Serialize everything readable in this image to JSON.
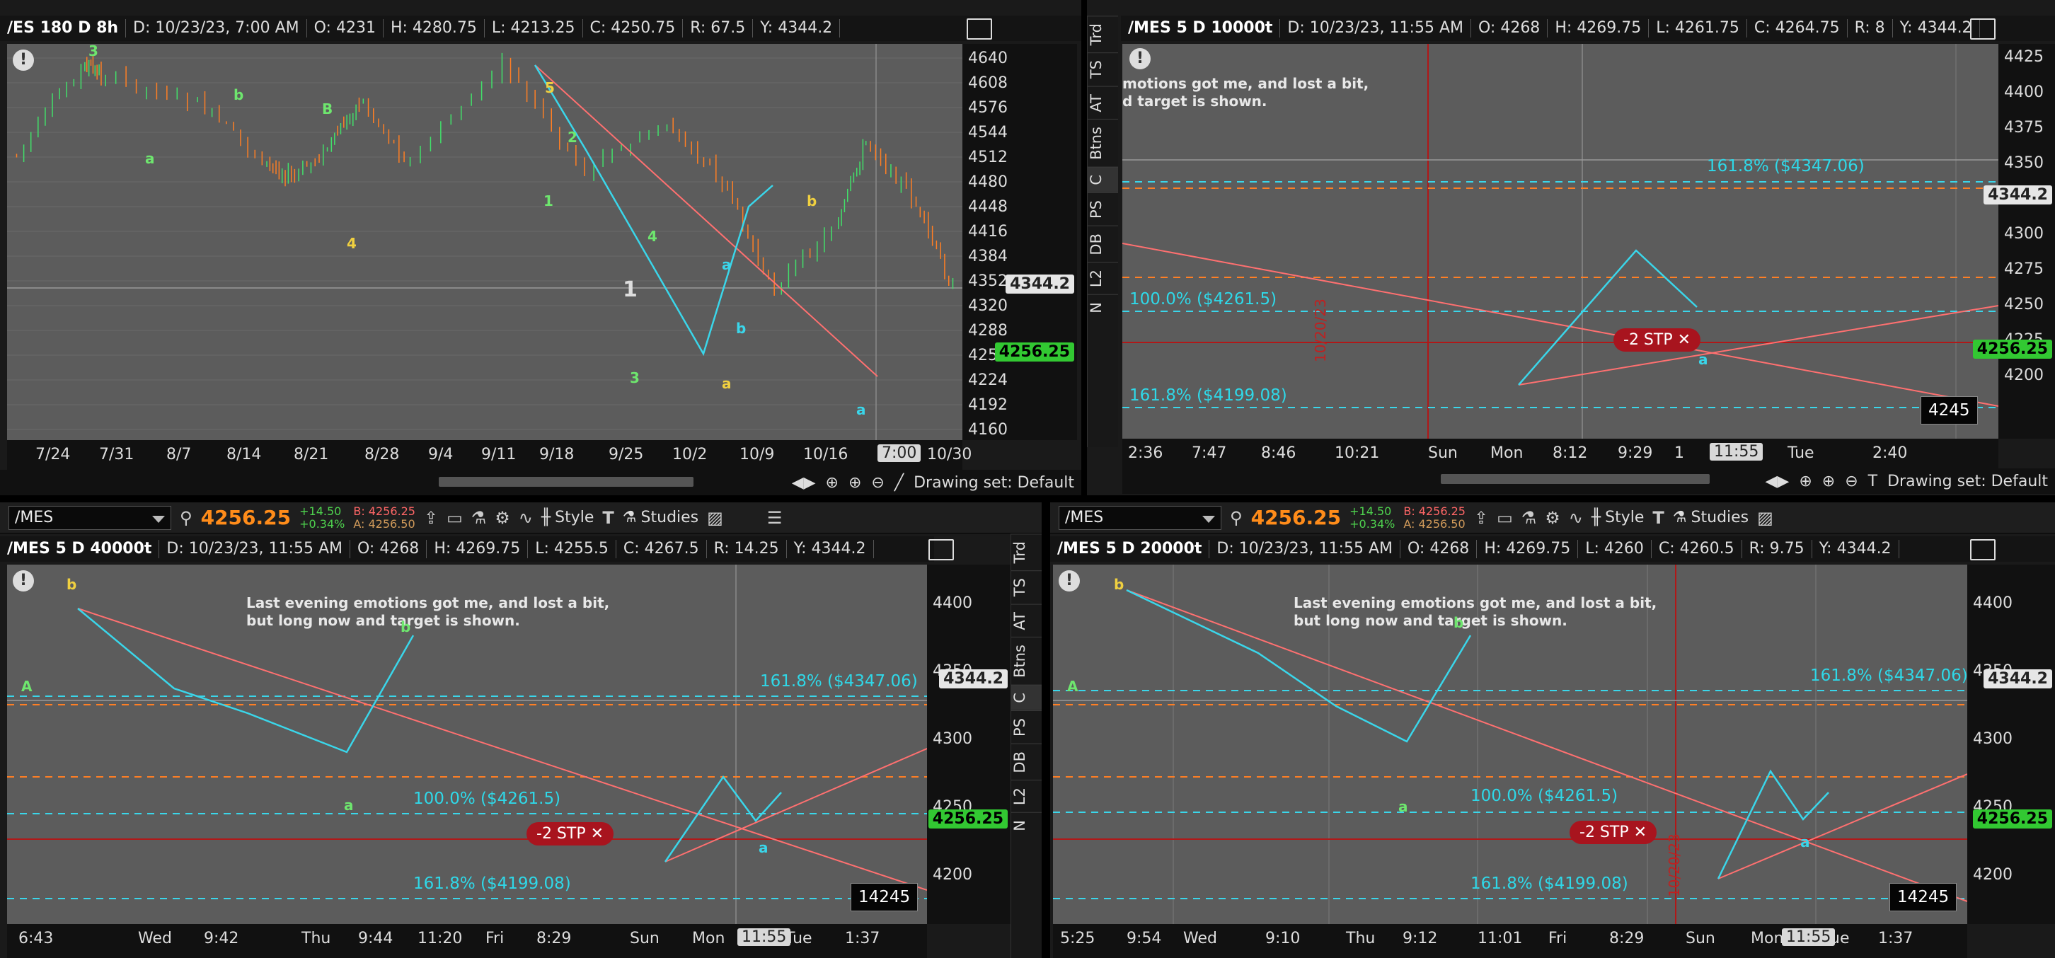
{
  "colors": {
    "bull": "#42e06a",
    "bear": "#ff7f24",
    "trend": "#ff7070",
    "wave": "#3ad6ea",
    "stp": "#a8141e"
  },
  "top_left": {
    "info": {
      "title": "/ES 180 D 8h",
      "date": "D: 10/23/23, 7:00 AM",
      "open": "O: 4231",
      "high": "H: 4280.75",
      "low": "L: 4213.25",
      "close": "C: 4250.75",
      "range": "R: 67.5",
      "y": "Y: 4344.2"
    },
    "y_labels": [
      "4640",
      "4608",
      "4576",
      "4544",
      "4512",
      "4480",
      "4448",
      "4416",
      "4384",
      "4352",
      "4320",
      "4288",
      "4256",
      "4224",
      "4192",
      "4160"
    ],
    "y_ref": "4344.2",
    "y_cur": "4256.25",
    "x_labels": [
      "7/24",
      "7/31",
      "8/7",
      "8/14",
      "8/21",
      "8/28",
      "9/4",
      "9/11",
      "9/18",
      "9/25",
      "10/2",
      "10/9",
      "10/16",
      "10/30"
    ],
    "x_cursor": "7:00",
    "drawing_set": "Drawing set: Default",
    "wave_labels": [
      {
        "t": "3",
        "c": "g"
      },
      {
        "t": "b",
        "c": "g"
      },
      {
        "t": "B",
        "c": "g"
      },
      {
        "t": "a",
        "c": "g"
      },
      {
        "t": "4",
        "c": "y"
      },
      {
        "t": "5",
        "c": "y"
      },
      {
        "t": "2",
        "c": "g"
      },
      {
        "t": "1",
        "c": "g"
      },
      {
        "t": "4",
        "c": "g"
      },
      {
        "t": "1",
        "c": "w"
      },
      {
        "t": "3",
        "c": "g"
      },
      {
        "t": "a",
        "c": "y"
      },
      {
        "t": "a",
        "c": "c"
      },
      {
        "t": "b",
        "c": "c"
      },
      {
        "t": "b",
        "c": "y"
      },
      {
        "t": "a",
        "c": "c"
      }
    ]
  },
  "top_right": {
    "info": {
      "title": "/MES 5 D 10000t",
      "date": "D: 10/23/23, 11:55 AM",
      "open": "O: 4268",
      "high": "H: 4269.75",
      "low": "L: 4261.75",
      "close": "C: 4264.75",
      "range": "R: 8",
      "y": "Y: 4344.2"
    },
    "y_labels": [
      "4425",
      "4400",
      "4375",
      "4350",
      "4325",
      "4300",
      "4275",
      "4250",
      "4225",
      "4200"
    ],
    "y_ref": "4344.2",
    "y_cur": "4256.25",
    "x_labels": [
      "2:36",
      "7:47",
      "8:46",
      "10:21",
      "Sun",
      "Mon",
      "8:12",
      "9:29",
      "1",
      "Tue",
      "2:40"
    ],
    "x_cursor": "11:55",
    "note": "motions got me, and lost a bit,\nd target is shown.",
    "fib_top": "161.8%  ($4347.06)",
    "fib_mid": "100.0%  ($4261.5)",
    "fib_bot": "161.8%  ($4199.08)",
    "stp": "-2 STP",
    "box": "4245",
    "date_label": "10/20/23",
    "drawing_set": "Drawing set: Default",
    "wave_a": "a",
    "side_tabs": [
      "Trd",
      "TS",
      "AT",
      "Btns",
      "C",
      "PS",
      "DB",
      "L2",
      "N"
    ]
  },
  "bottom_left": {
    "toolbar": {
      "symbol": "/MES",
      "price": "4256.25",
      "chg": "+14.50",
      "pct": "+0.34%",
      "bid": "B: 4256.25",
      "ask": "A: 4256.50",
      "style": "Style",
      "studies": "Studies"
    },
    "info": {
      "title": "/MES 5 D 40000t",
      "date": "D: 10/23/23, 11:55 AM",
      "open": "O: 4268",
      "high": "H: 4269.75",
      "low": "L: 4255.5",
      "close": "C: 4267.5",
      "range": "R: 14.25",
      "y": "Y: 4344.2"
    },
    "y_labels": [
      "4400",
      "4350",
      "4300",
      "4250",
      "4200"
    ],
    "y_ref": "4344.2",
    "y_cur": "4256.25",
    "x_labels": [
      "6:43",
      "Wed",
      "9:42",
      "Thu",
      "9:44",
      "11:20",
      "Fri",
      "8:29",
      "Sun",
      "Mon",
      "Tue",
      "1:37"
    ],
    "x_cursor": "11:55",
    "note": "Last evening emotions got me, and lost a bit,\nbut long now and target is shown.",
    "fib_top": "161.8%  ($4347.06)",
    "fib_mid": "100.0%  ($4261.5)",
    "fib_bot": "161.8%  ($4199.08)",
    "stp": "-2 STP",
    "box": "14245",
    "wave_labels": [
      {
        "t": "b",
        "c": "y"
      },
      {
        "t": "A",
        "c": "g"
      },
      {
        "t": "b",
        "c": "g"
      },
      {
        "t": "a",
        "c": "g"
      },
      {
        "t": "a",
        "c": "c"
      }
    ],
    "side_tabs": [
      "Trd",
      "TS",
      "AT",
      "Btns",
      "C",
      "PS",
      "DB",
      "L2",
      "N"
    ]
  },
  "bottom_right": {
    "toolbar": {
      "symbol": "/MES",
      "price": "4256.25",
      "chg": "+14.50",
      "pct": "+0.34%",
      "bid": "B: 4256.25",
      "ask": "A: 4256.50",
      "style": "Style",
      "studies": "Studies"
    },
    "info": {
      "title": "/MES 5 D 20000t",
      "date": "D: 10/23/23, 11:55 AM",
      "open": "O: 4268",
      "high": "H: 4269.75",
      "low": "L: 4260",
      "close": "C: 4260.5",
      "range": "R: 9.75",
      "y": "Y: 4344.2"
    },
    "y_labels": [
      "4400",
      "4350",
      "4300",
      "4250",
      "4200"
    ],
    "y_ref": "4344.2",
    "y_cur": "4256.25",
    "x_labels": [
      "5:25",
      "9:54",
      "Wed",
      "9:10",
      "Thu",
      "9:12",
      "11:01",
      "Fri",
      "8:29",
      "Sun",
      "Mon",
      "ue",
      "1:37"
    ],
    "x_cursor": "11:55",
    "note": "Last evening emotions got me, and lost a bit,\nbut long now and target is shown.",
    "fib_top": "161.8%  ($4347.06)",
    "fib_mid": "100.0%  ($4261.5)",
    "fib_bot": "161.8%  ($4199.08)",
    "stp": "-2 STP",
    "box": "14245",
    "date_label": "10/20/23",
    "wave_labels": [
      {
        "t": "b",
        "c": "y"
      },
      {
        "t": "A",
        "c": "g"
      },
      {
        "t": "b",
        "c": "g"
      },
      {
        "t": "a",
        "c": "g"
      },
      {
        "t": "a",
        "c": "c"
      }
    ]
  }
}
